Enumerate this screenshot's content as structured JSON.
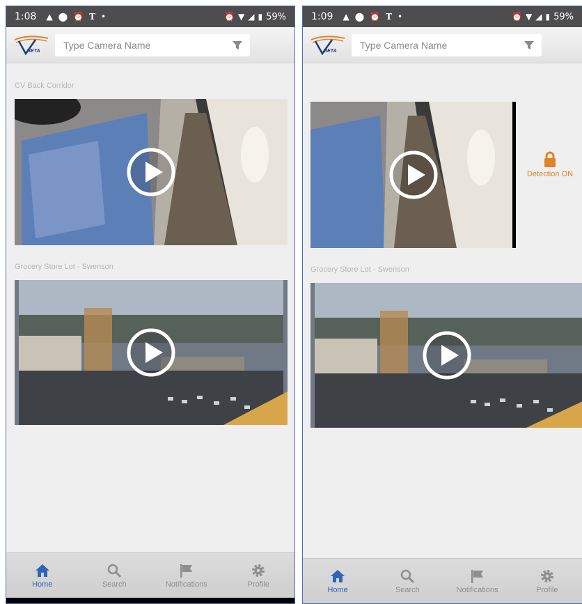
{
  "colors": {
    "status_bar": "#4d4d4d",
    "accent_blue": "#2f64b8",
    "detection_orange": "#e0822a",
    "nav_inactive": "#8e8e8e",
    "background": "#efefef"
  },
  "screens": [
    {
      "status": {
        "time": "1:08",
        "battery": "59%",
        "left_icons": [
          "navigation-icon",
          "app-notification-icon",
          "alarm-icon",
          "news-icon",
          "dot-icon"
        ],
        "right_icons": [
          "alarm-icon",
          "wifi-icon",
          "signal-icon",
          "battery-icon"
        ]
      },
      "header": {
        "logo_text": "BETA",
        "search_placeholder": "Type Camera Name",
        "search_value": ""
      },
      "cameras": [
        {
          "label": "CV Back Corridor",
          "scene": "corridor"
        },
        {
          "label": "Grocery Store Lot - Swenson",
          "scene": "parking-lot"
        }
      ],
      "nav": [
        {
          "label": "Home",
          "icon": "home-icon",
          "active": true
        },
        {
          "label": "Search",
          "icon": "search-icon",
          "active": false
        },
        {
          "label": "Notifications",
          "icon": "flag-icon",
          "active": false
        },
        {
          "label": "Profile",
          "icon": "gear-icon",
          "active": false
        }
      ]
    },
    {
      "status": {
        "time": "1:09",
        "battery": "59%",
        "left_icons": [
          "navigation-icon",
          "app-notification-icon",
          "alarm-icon",
          "news-icon",
          "dot-icon"
        ],
        "right_icons": [
          "alarm-icon",
          "wifi-icon",
          "signal-icon",
          "battery-icon"
        ]
      },
      "header": {
        "logo_text": "BETA",
        "search_placeholder": "Type Camera Name",
        "search_value": ""
      },
      "cameras": [
        {
          "label": "",
          "scene": "corridor"
        },
        {
          "label": "Grocery Store Lot - Swenson",
          "scene": "parking-lot"
        }
      ],
      "detection": {
        "label": "Detection ON",
        "icon": "lock-icon"
      },
      "nav": [
        {
          "label": "Home",
          "icon": "home-icon",
          "active": true
        },
        {
          "label": "Search",
          "icon": "search-icon",
          "active": false
        },
        {
          "label": "Notifications",
          "icon": "flag-icon",
          "active": false
        },
        {
          "label": "Profile",
          "icon": "gear-icon",
          "active": false
        }
      ]
    }
  ]
}
